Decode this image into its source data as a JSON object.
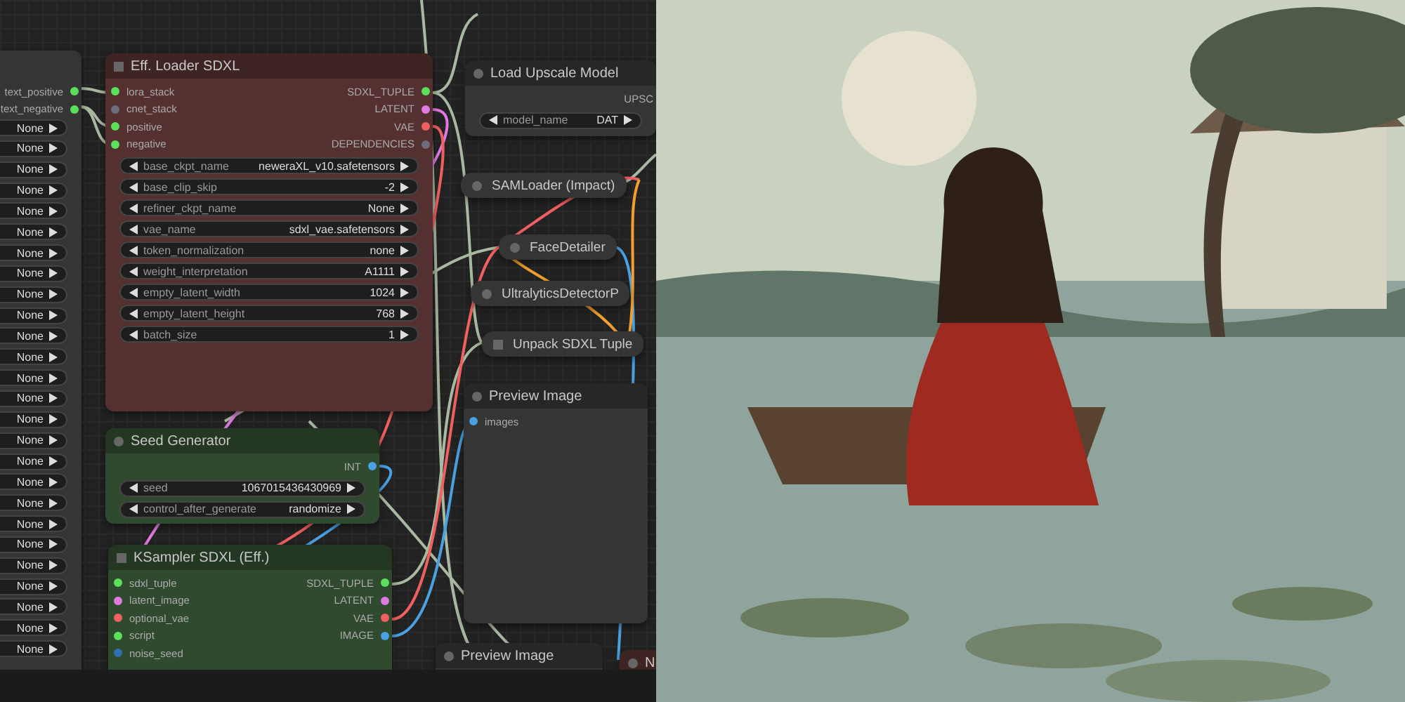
{
  "nodes": [
    {
      "kind": "full",
      "color": "#353535",
      "outputs": [
        {
          "label": "text_positive",
          "color": "#5be05b"
        },
        {
          "label": "text_negative",
          "color": "#5be05b"
        }
      ],
      "widgets": [
        {
          "value": "None"
        },
        {
          "value": "None"
        },
        {
          "value": "None"
        },
        {
          "value": "None"
        },
        {
          "value": "None"
        },
        {
          "value": "None"
        },
        {
          "value": "None"
        },
        {
          "value": "None"
        },
        {
          "value": "None"
        },
        {
          "value": "None"
        },
        {
          "value": "None"
        },
        {
          "value": "None"
        },
        {
          "value": "None"
        },
        {
          "value": "None"
        },
        {
          "value": "None"
        },
        {
          "value": "None"
        },
        {
          "value": "None"
        },
        {
          "value": "None"
        },
        {
          "value": "None"
        },
        {
          "value": "None"
        },
        {
          "value": "None"
        },
        {
          "value": "None"
        },
        {
          "value": "None"
        },
        {
          "value": "None"
        },
        {
          "value": "None"
        },
        {
          "value": "None"
        }
      ]
    },
    {
      "kind": "full",
      "color": "#553030",
      "square_marker": true,
      "title": "Eff. Loader SDXL",
      "inputs": [
        {
          "label": "lora_stack",
          "color": "#5be05b"
        },
        {
          "label": "cnet_stack",
          "color": "#6c6c7c"
        },
        {
          "label": "positive",
          "color": "#5be05b"
        },
        {
          "label": "negative",
          "color": "#5be05b"
        }
      ],
      "outputs": [
        {
          "label": "SDXL_TUPLE",
          "color": "#5be05b"
        },
        {
          "label": "LATENT",
          "color": "#e07ae0"
        },
        {
          "label": "VAE",
          "color": "#f06060"
        },
        {
          "label": "DEPENDENCIES",
          "color": "#6c6c7c"
        }
      ],
      "widgets": [
        {
          "label": "base_ckpt_name",
          "value": "neweraXL_v10.safetensors"
        },
        {
          "label": "base_clip_skip",
          "value": "-2"
        },
        {
          "label": "refiner_ckpt_name",
          "value": "None"
        },
        {
          "label": "vae_name",
          "value": "sdxl_vae.safetensors"
        },
        {
          "label": "token_normalization",
          "value": "none"
        },
        {
          "label": "weight_interpretation",
          "value": "A1111"
        },
        {
          "label": "empty_latent_width",
          "value": "1024"
        },
        {
          "label": "empty_latent_height",
          "value": "768"
        },
        {
          "label": "batch_size",
          "value": "1"
        }
      ]
    },
    {
      "kind": "full",
      "color": "#353535",
      "square_marker": false,
      "title": "Load Upscale Model",
      "outputs": [
        {
          "label": "UPSC"
        }
      ],
      "widgets": [
        {
          "label": "model_name",
          "value": "DAT"
        }
      ]
    },
    {
      "kind": "collapsed",
      "square_marker": false,
      "title": "SAMLoader (Impact)"
    },
    {
      "kind": "collapsed",
      "square_marker": false,
      "title": "FaceDetailer"
    },
    {
      "kind": "collapsed",
      "square_marker": false,
      "title": "UltralyticsDetectorP"
    },
    {
      "kind": "collapsed",
      "square_marker": true,
      "title": "Unpack SDXL Tuple"
    },
    {
      "kind": "full",
      "color": "#353535",
      "square_marker": false,
      "title": "Preview Image",
      "inputs": [
        {
          "label": "images",
          "color": "#4aa0e0"
        }
      ]
    },
    {
      "kind": "full",
      "color": "#2f4a2f",
      "square_marker": false,
      "title": "Seed Generator",
      "outputs": [
        {
          "label": "INT",
          "color": "#4aa0e0"
        }
      ],
      "widgets": [
        {
          "label": "seed",
          "value": "1067015436430969"
        },
        {
          "label": "control_after_generate",
          "value": "randomize"
        }
      ]
    },
    {
      "kind": "full",
      "color": "#2f4a2f",
      "square_marker": true,
      "title": "KSampler SDXL (Eff.)",
      "inputs": [
        {
          "label": "sdxl_tuple",
          "color": "#5be05b"
        },
        {
          "label": "latent_image",
          "color": "#e07ae0"
        },
        {
          "label": "optional_vae",
          "color": "#f06060"
        },
        {
          "label": "script",
          "color": "#5be05b"
        },
        {
          "label": "noise_seed",
          "color": "#2f70b0"
        }
      ],
      "outputs": [
        {
          "label": "SDXL_TUPLE",
          "color": "#5be05b"
        },
        {
          "label": "LATENT",
          "color": "#e07ae0"
        },
        {
          "label": "VAE",
          "color": "#f06060"
        },
        {
          "label": "IMAGE",
          "color": "#4aa0e0"
        }
      ]
    },
    {
      "kind": "full",
      "color": "#353535",
      "square_marker": false,
      "title": "Preview Image"
    },
    {
      "kind": "full",
      "color": "#553030",
      "square_marker": false,
      "title": "N"
    }
  ]
}
